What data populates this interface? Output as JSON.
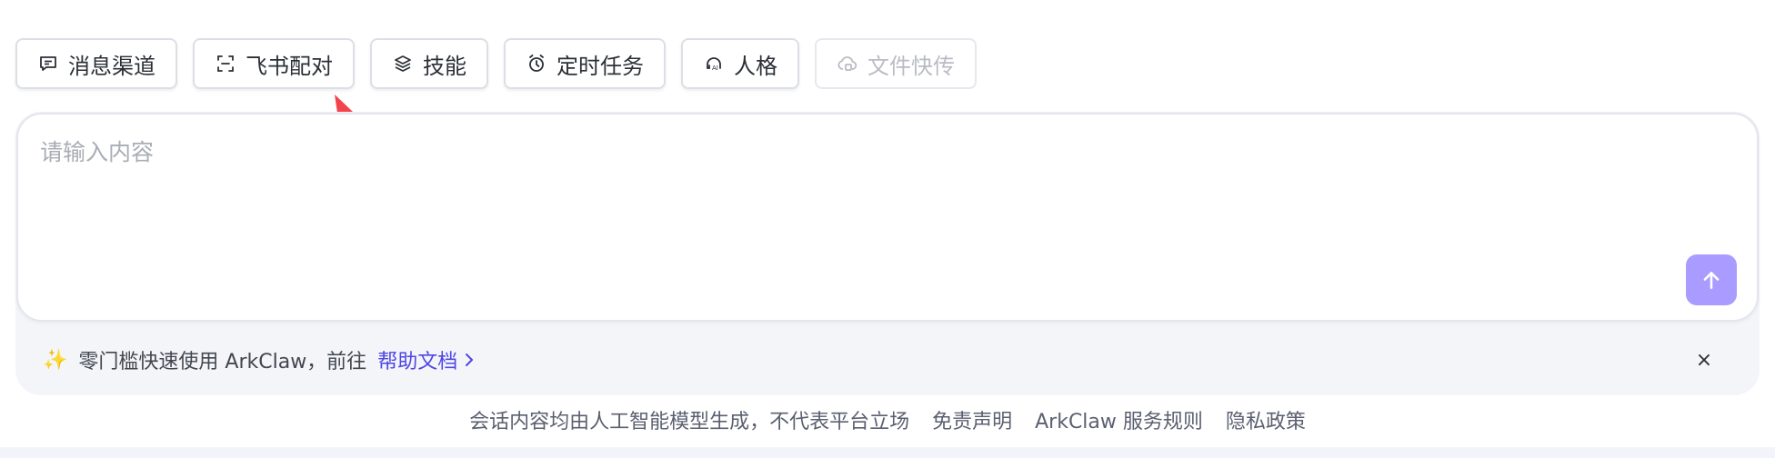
{
  "toolbar": {
    "buttons": [
      {
        "label": "消息渠道",
        "icon": "message-channel-icon"
      },
      {
        "label": "飞书配对",
        "icon": "scan-icon"
      },
      {
        "label": "技能",
        "icon": "layers-icon"
      },
      {
        "label": "定时任务",
        "icon": "alarm-clock-icon"
      },
      {
        "label": "人格",
        "icon": "ai-persona-icon"
      },
      {
        "label": "文件快传",
        "icon": "cloud-upload-icon",
        "disabled": true
      }
    ]
  },
  "composer": {
    "placeholder": "请输入内容",
    "send_icon": "arrow-up-icon"
  },
  "tip": {
    "icon": "sparkle-icon",
    "text": "零门槛快速使用 ArkClaw，前往",
    "link_text": "帮助文档",
    "close_glyph": "×"
  },
  "footer": {
    "notice": "会话内容均由人工智能模型生成，不代表平台立场",
    "links": [
      "免责声明",
      "ArkClaw 服务规则",
      "隐私政策"
    ]
  },
  "colors": {
    "accent": "#4f46e5",
    "send_button": "#a99bff",
    "annotation_arrow": "#f5434b"
  }
}
